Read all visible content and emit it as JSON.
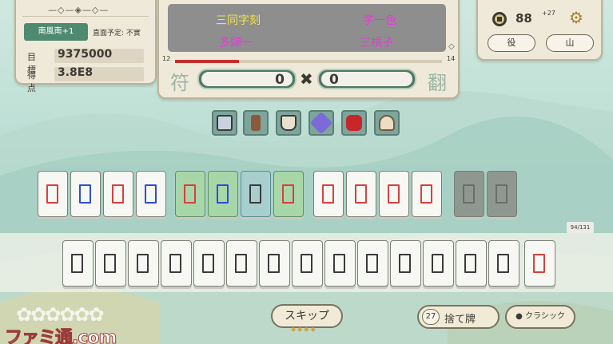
{
  "left_panel": {
    "ornament": "—◇—◈—◇—",
    "round": "南風南+1",
    "round_note": "直面予定: 不實",
    "target_label": "目標",
    "target_value": "9375000",
    "score_label": "得点",
    "score_value": "3.8E8"
  },
  "yaku": [
    "三同字刻",
    "字一色",
    "多歸一",
    "三槓子"
  ],
  "progress": {
    "min_label": "12",
    "max_label": "14",
    "fill_fraction": 0.24
  },
  "fu_label": "符",
  "han_label": "翻",
  "fu_value": "0",
  "times": "✖",
  "han_value": "0",
  "right_panel": {
    "coins": "88",
    "coin_delta": "+27",
    "yaku_button": "役",
    "wall_button": "山"
  },
  "items": [
    "fan-item",
    "brush-item",
    "tea-cup-item",
    "crane-item",
    "firecracker-item",
    "dumpling-item"
  ],
  "tile_counter": "94/131",
  "actions": {
    "skip": "スキップ",
    "discard_count": "27",
    "discard": "捨て牌",
    "classic": "● クラシック"
  },
  "decor": {
    "flowers": "✿✿✿✿✿✿"
  },
  "watermark": "ファミ通.com",
  "colors": {
    "accent_green": "#4e8a6f",
    "tile_red": "#d6413c",
    "tile_blue": "#2f4ed1"
  }
}
